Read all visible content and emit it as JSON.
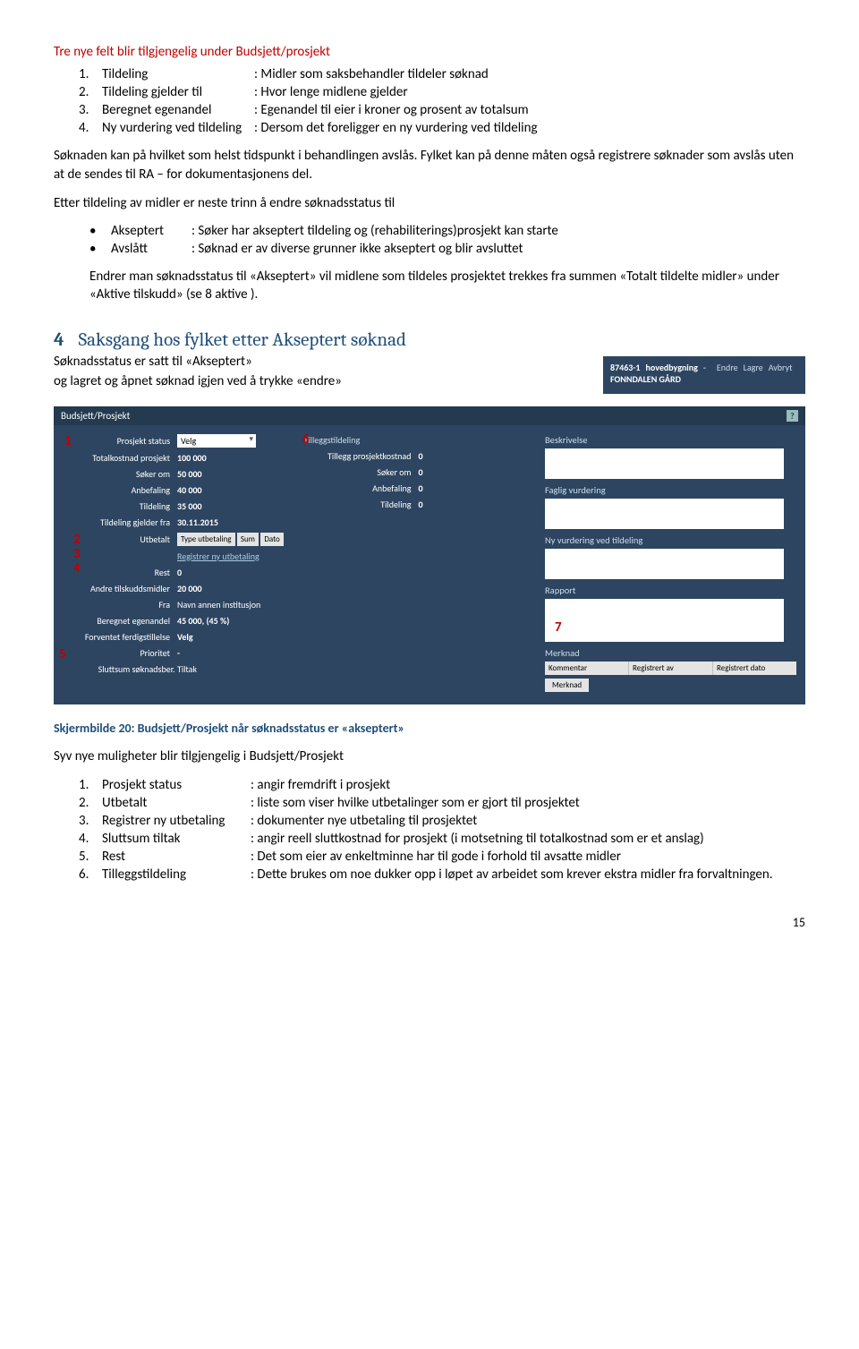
{
  "intro_heading": "Tre nye felt blir tilgjengelig under Budsjett/prosjekt",
  "fields1": [
    {
      "n": "1.",
      "term": "Tildeling",
      "desc": ": Midler som saksbehandler tildeler søknad"
    },
    {
      "n": "2.",
      "term": "Tildeling gjelder til",
      "desc": ": Hvor lenge midlene gjelder"
    },
    {
      "n": "3.",
      "term": "Beregnet egenandel",
      "desc": ": Egenandel til eier i kroner og prosent av totalsum"
    },
    {
      "n": "4.",
      "term": "Ny vurdering ved tildeling",
      "desc": ": Dersom det foreligger en ny vurdering ved tildeling"
    }
  ],
  "para1": "Søknaden kan på hvilket som helst tidspunkt i behandlingen avslås. Fylket kan på denne måten også registrere søknader som avslås uten at de sendes til RA – for dokumentasjonens del.",
  "para2": "Etter tildeling av midler er neste trinn å endre søknadsstatus til",
  "bullets": [
    {
      "term": "Akseptert",
      "desc": ": Søker har akseptert tildeling og (rehabiliterings)prosjekt kan starte"
    },
    {
      "term": "Avslått",
      "desc": ": Søknad er av diverse grunner ikke akseptert og blir avsluttet"
    }
  ],
  "para3": "Endrer man søknadsstatus til «Akseptert» vil midlene som tildeles prosjektet trekkes fra summen «Totalt tildelte midler» under «Aktive tilskudd» (se 8 aktive ).",
  "section4": {
    "num": "4",
    "title": "Saksgang hos fylket etter Akseptert søknad"
  },
  "section4_sub_a": "Søknadsstatus er satt til «Akseptert»",
  "section4_sub_b": "og lagret og åpnet søknad igjen ved å trykke «endre»",
  "mini_toolbar": {
    "id": "87463-1",
    "name1": "hovedbygning",
    "name2": "FONNDALEN GÅRD",
    "endre": "Endre",
    "lagre": "Lagre",
    "avbryt": "Avbryt"
  },
  "panel": {
    "title": "Budsjett/Prosjekt",
    "left": {
      "prosjekt_status_l": "Prosjekt status",
      "prosjekt_status_v": "Velg",
      "totalk_l": "Totalkostnad prosjekt",
      "totalk_v": "100 000",
      "soker_l": "Søker om",
      "soker_v": "50 000",
      "anbefal_l": "Anbefaling",
      "anbefal_v": "40 000",
      "tildel_l": "Tildeling",
      "tildel_v": "35 000",
      "gjelder_l": "Tildeling gjelder fra",
      "gjelder_v": "30.11.2015",
      "utbet_l": "Utbetalt",
      "utbet_head_a": "Type utbetaling",
      "utbet_head_b": "Sum",
      "utbet_head_c": "Dato",
      "reg_link": "Registrer ny utbetaling",
      "rest_l": "Rest",
      "rest_v": "0",
      "andre_l": "Andre tilskuddsmidler",
      "andre_v": "20 000",
      "fra_l": "Fra",
      "fra_v": "Navn annen institusjon",
      "egen_l": "Beregnet egenandel",
      "egen_v": "45 000, (45 %)",
      "ferdig_l": "Forventet ferdigstillelse",
      "ferdig_v": "Velg",
      "pri_l": "Prioritet",
      "pri_v": "-",
      "slutt_l": "Sluttsum søknadsber. Tiltak"
    },
    "mid": {
      "tillegg_h": "Tilleggstildeling",
      "tpk_l": "Tillegg prosjektkostnad",
      "tpk_v": "0",
      "soker_l": "Søker om",
      "soker_v": "0",
      "anbefal_l": "Anbefaling",
      "anbefal_v": "0",
      "tildel_l": "Tildeling",
      "tildel_v": "0"
    },
    "right": {
      "besk": "Beskrivelse",
      "fag": "Faglig vurdering",
      "nyv": "Ny vurdering ved tildeling",
      "rap": "Rapport",
      "merk": "Merknad",
      "merk_a": "Kommentar",
      "merk_b": "Registrert av",
      "merk_c": "Registrert dato",
      "merk_btn": "Merknad"
    },
    "marks": {
      "m1": "1",
      "m2": "2",
      "m3": "3",
      "m4": "4",
      "m5": "5",
      "m6": "6",
      "m7": "7"
    }
  },
  "caption": "Skjermbilde 20: Budsjett/Prosjekt når søknadsstatus er «akseptert»",
  "seven_heading": "Syv nye muligheter blir tilgjengelig i Budsjett/Prosjekt",
  "fields2": [
    {
      "n": "1.",
      "term": "Prosjekt status",
      "desc": ": angir fremdrift i prosjekt"
    },
    {
      "n": "2.",
      "term": "Utbetalt",
      "desc": ": liste som viser hvilke utbetalinger som er gjort til prosjektet"
    },
    {
      "n": "3.",
      "term": "Registrer ny utbetaling",
      "desc": ": dokumenter nye utbetaling til prosjektet"
    },
    {
      "n": "4.",
      "term": "Sluttsum tiltak",
      "desc": ": angir reell sluttkostnad for prosjekt (i motsetning til totalkostnad som er et anslag)"
    },
    {
      "n": "5.",
      "term": "Rest",
      "desc": ": Det som eier av enkeltminne har til gode i forhold til avsatte midler"
    },
    {
      "n": "6.",
      "term": "Tilleggstildeling",
      "desc": ": Dette brukes om noe dukker opp i løpet av arbeidet som krever ekstra midler fra forvaltningen."
    }
  ],
  "page_number": "15"
}
